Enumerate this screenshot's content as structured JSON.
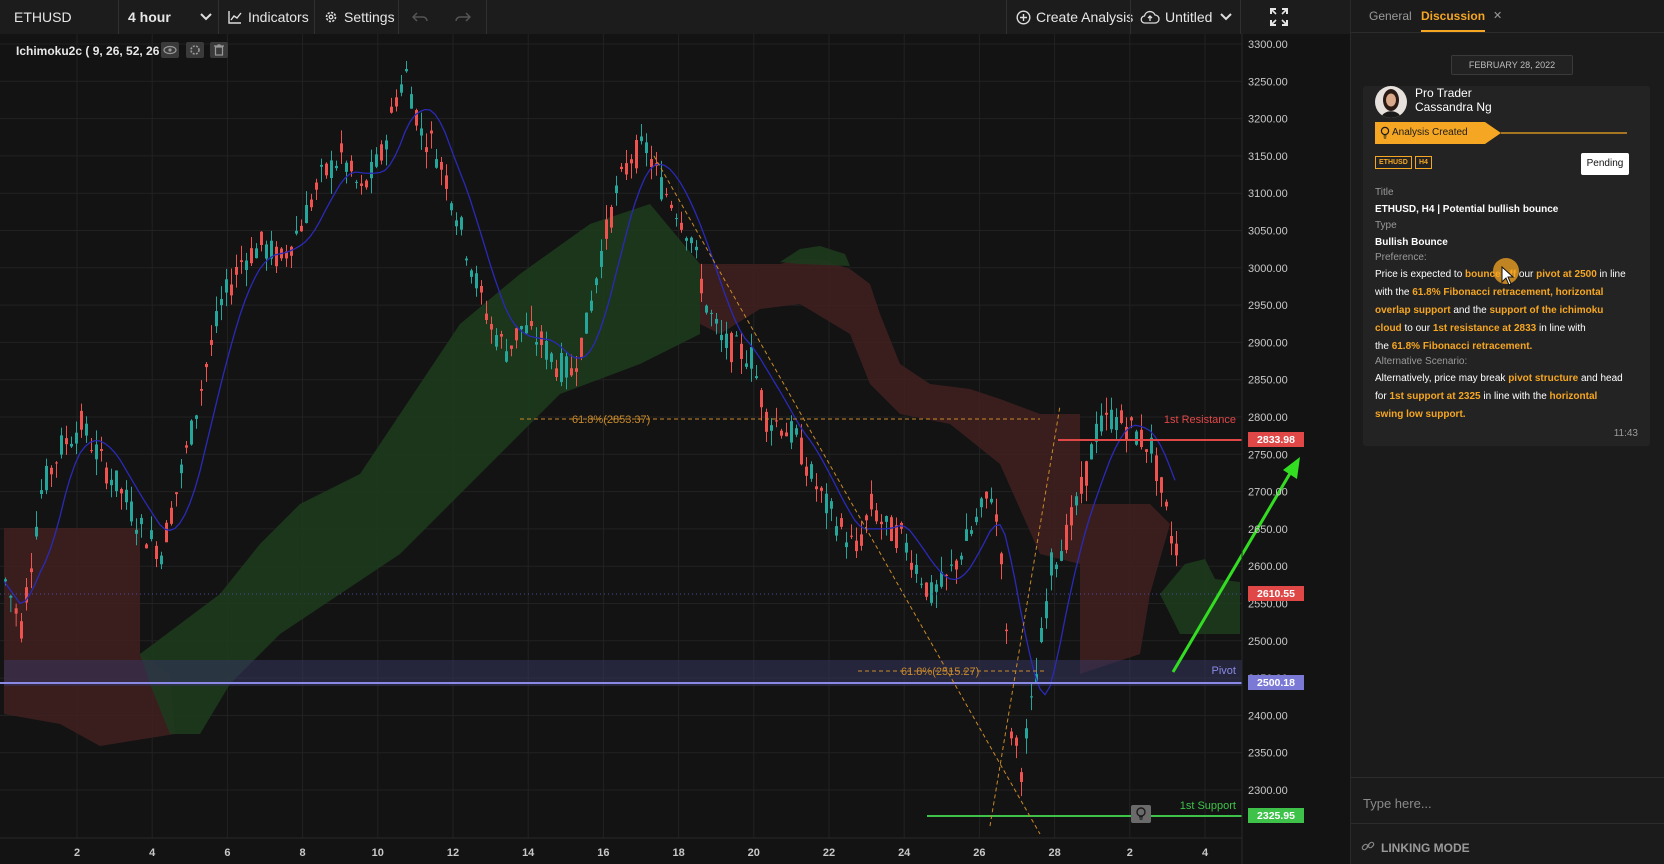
{
  "toolbar": {
    "symbol": "ETHUSD",
    "timeframe": "4 hour",
    "indicators_label": "Indicators",
    "settings_label": "Settings",
    "create_analysis_label": "Create Analysis",
    "layout_name": "Untitled"
  },
  "indicator": {
    "label": "Ichimoku2c ( 9, 26, 52, 26 )"
  },
  "chart": {
    "price_labels": [
      "3300.00",
      "3250.00",
      "3200.00",
      "3150.00",
      "3100.00",
      "3050.00",
      "3000.00",
      "2950.00",
      "2900.00",
      "2850.00",
      "2800.00",
      "2750.00",
      "2700.00",
      "2650.00",
      "2600.00",
      "2550.00",
      "2500.00",
      "2450.00",
      "2400.00",
      "2350.00",
      "2300.00"
    ],
    "date_labels": [
      "2",
      "4",
      "6",
      "8",
      "10",
      "12",
      "14",
      "16",
      "18",
      "20",
      "22",
      "24",
      "26",
      "28",
      "2",
      "4"
    ],
    "fib_label_upper": "61.8%(2853.37)",
    "fib_label_lower": "61.8%(2515.27)",
    "resistance_label": "1st Resistance",
    "resistance_value": "2833.98",
    "pivot_label": "Pivot",
    "pivot_value": "2500.18",
    "support_label": "1st Support",
    "support_value": "2325.95",
    "current_price": "2610.55",
    "colors": {
      "up": "#26a69a",
      "down": "#ef5350",
      "resistance": "#e04848",
      "support": "#3ec24a",
      "pivot": "#8a8ae6",
      "arrow": "#33dd22",
      "cloud_bull": "#1d3b1d",
      "cloud_bear": "#3f2020"
    }
  },
  "panel": {
    "tab_general": "General",
    "tab_discussion": "Discussion",
    "date_divider": "FEBRUARY 28, 2022",
    "author_role": "Pro Trader",
    "author_name": "Cassandra Ng",
    "analysis_badge": "Analysis Created",
    "tag_symbol": "ETHUSD",
    "tag_timeframe": "H4",
    "status": "Pending",
    "title_label": "Title",
    "title_value": "ETHUSD, H4 | Potential bullish bounce",
    "type_label": "Type",
    "type_value": "Bullish Bounce",
    "preference_label": "Preference:",
    "pref_1a": "Price is expected to ",
    "pref_1b": "bounce off",
    "pref_1c": " our ",
    "pref_1d": "pivot at 2500",
    "pref_1e": " in line",
    "pref_2a": "with the ",
    "pref_2b": "61.8% Fibonacci retracement, horizontal",
    "pref_3a": "overlap support",
    "pref_3b": " and the ",
    "pref_3c": "support of the ichimoku",
    "pref_4a": "cloud",
    "pref_4b": " to our ",
    "pref_4c": "1st resistance at 2833",
    "pref_4d": " in line with",
    "pref_5a": "the ",
    "pref_5b": "61.8% Fibonacci retracement.",
    "alt_label": "Alternative Scenario:",
    "alt_1a": "Alternatively, price may break ",
    "alt_1b": "pivot structure",
    "alt_1c": " and head",
    "alt_2a": "for ",
    "alt_2b": "1st support at 2325",
    "alt_2c": " in line with the ",
    "alt_2d": "horizontal",
    "alt_3a": "swing low support.",
    "time": "11:43",
    "input_placeholder": "Type here...",
    "linking_mode": "LINKING MODE"
  }
}
